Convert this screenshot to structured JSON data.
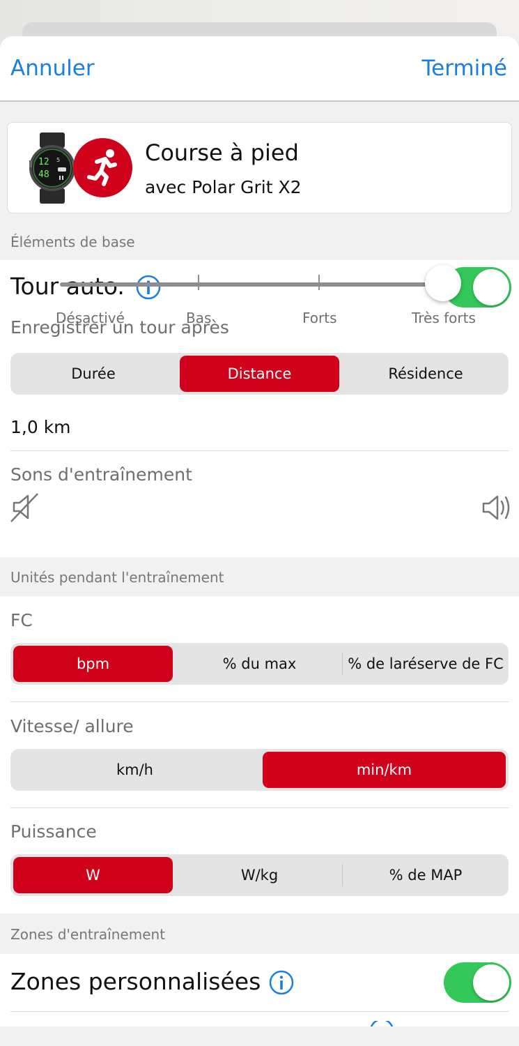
{
  "nav": {
    "cancel_label": "Annuler",
    "done_label": "Terminé"
  },
  "device_card": {
    "title": "Course à pied",
    "subtitle": "avec Polar Grit X2",
    "watch_display": [
      "12",
      "48",
      "5"
    ],
    "badge_color": "#d0021b"
  },
  "basics": {
    "section_title": "Éléments de base",
    "auto_lap": {
      "label": "Tour auto.",
      "enabled": true,
      "record_after_label": "Enregistrer un tour après",
      "options": [
        "Durée",
        "Distance",
        "Résidence"
      ],
      "selected": "Distance",
      "value": "1,0 km"
    },
    "sounds": {
      "label": "Sons d'entraînement",
      "levels": [
        "Désactivé",
        "Bas",
        "Forts",
        "Très forts"
      ],
      "selected": "Très forts"
    }
  },
  "units": {
    "section_title": "Unités pendant l'entraînement",
    "hr": {
      "label": "FC",
      "options": [
        "bpm",
        "% du max",
        "% de laréserve de FC"
      ],
      "selected": "bpm"
    },
    "speed": {
      "label": "Vitesse/ allure",
      "options": [
        "km/h",
        "min/km"
      ],
      "selected": "min/km"
    },
    "power": {
      "label": "Puissance",
      "options": [
        "W",
        "W/kg",
        "% de MAP"
      ],
      "selected": "W"
    }
  },
  "zones": {
    "section_title": "Zones d'entraînement",
    "custom_zones": {
      "label": "Zones personnalisées",
      "enabled": true
    }
  },
  "colors": {
    "accent": "#d0021b",
    "link": "#1a7fe0",
    "toggle_on": "#34c759"
  }
}
